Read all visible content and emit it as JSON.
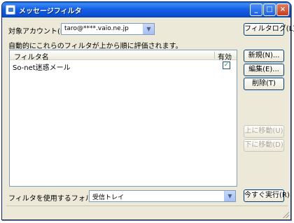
{
  "window": {
    "title": "メッセージフィルタ",
    "minimize_glyph": "_",
    "maximize_glyph": "□",
    "close_glyph": "×"
  },
  "account": {
    "label": "対象アカウント(E):",
    "value": "taro@****.vaio.ne.jp",
    "dropdown_glyph": "▼"
  },
  "buttons": {
    "filter_log": "フィルタログ(L)",
    "new": "新規(N)...",
    "edit": "編集(E)...",
    "delete": "削除(T)",
    "move_up": "上に移動(U)",
    "move_down": "下に移動(D)",
    "run_now": "今すぐ実行(R)"
  },
  "description": "自動的にこれらのフィルタが上から順に評価されます。",
  "list": {
    "columns": {
      "name": "フィルタ名",
      "enabled": "有効"
    },
    "rows": [
      {
        "name": "So-net迷惑メール",
        "enabled_glyph": "✓"
      }
    ]
  },
  "folder": {
    "label": "フィルタを使用するフォルダ(O):",
    "value": "受信トレイ",
    "dropdown_glyph": "▼"
  },
  "icons": {
    "title": "message-filter-icon",
    "checkbox": "checkbox-checked-icon",
    "grip": "resize-grip-icon"
  }
}
